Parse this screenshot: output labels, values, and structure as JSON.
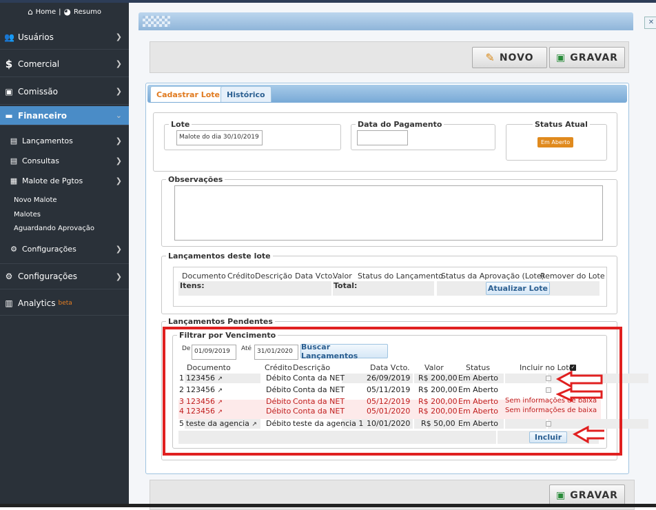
{
  "sidebar": {
    "home_label": "Home",
    "sep": "|",
    "resumo_label": "Resumo",
    "items": [
      {
        "label": "Usuários",
        "icon": "users-icon",
        "glyph": "👥"
      },
      {
        "label": "Comercial",
        "icon": "dollar-icon",
        "glyph": "$"
      },
      {
        "label": "Comissão",
        "icon": "money-icon",
        "glyph": "▣"
      },
      {
        "label": "Financeiro",
        "icon": "briefcase-icon",
        "glyph": "💼"
      }
    ],
    "financeiro_sub": [
      {
        "label": "Lançamentos",
        "icon": "file-icon",
        "glyph": "▤"
      },
      {
        "label": "Consultas",
        "icon": "file-text-icon",
        "glyph": "▤"
      },
      {
        "label": "Malote de Pgtos",
        "icon": "list-icon",
        "glyph": "▦"
      }
    ],
    "malote_sub": [
      "Novo Malote",
      "Malotes",
      "Aguardando Aprovação"
    ],
    "fin_config": "Configurações",
    "config": "Configurações",
    "analytics": "Analytics",
    "beta": "beta"
  },
  "toolbar": {
    "novo": "NOVO",
    "gravar": "GRAVAR"
  },
  "tabs": {
    "cadastrar": "Cadastrar Lote",
    "historico": "Histórico"
  },
  "lote": {
    "legend": "Lote",
    "value": "Malote do dia 30/10/2019"
  },
  "pagamento": {
    "legend": "Data do Pagamento",
    "value": ""
  },
  "status": {
    "legend": "Status Atual",
    "badge": "Em Aberto",
    "badge_color": "#e08a1e"
  },
  "observacoes": {
    "legend": "Observações"
  },
  "lancamentos_lote": {
    "legend": "Lançamentos deste lote",
    "headers": [
      "Documento",
      "Crédito",
      "Descrição",
      "Data Vcto.",
      "Valor",
      "Status do Lançamento",
      "Status da Aprovação (Lote)",
      "Remover do Lote"
    ],
    "itens_label": "Itens:",
    "total_label": "Total:",
    "atualizar": "Atualizar Lote"
  },
  "pendentes": {
    "legend": "Lançamentos Pendentes",
    "filtro_legend": "Filtrar por Vencimento",
    "de_label": "De",
    "de_value": "01/09/2019",
    "ate_label": "Até",
    "ate_value": "31/01/2020",
    "buscar": "Buscar Lançamentos",
    "headers": {
      "documento": "Documento",
      "credito": "Crédito",
      "descricao": "Descrição",
      "vcto": "Data Vcto.",
      "valor": "Valor",
      "status": "Status",
      "incluir": "Incluir no Lote"
    },
    "rows": [
      {
        "n": "1",
        "doc": "123456",
        "cred": "Débito",
        "desc": "Conta da NET",
        "vcto": "26/09/2019",
        "valor": "R$ 200,00",
        "status": "Em Aberto",
        "incl": "",
        "red": false
      },
      {
        "n": "2",
        "doc": "123456",
        "cred": "Débito",
        "desc": "Conta da NET",
        "vcto": "05/11/2019",
        "valor": "R$ 200,00",
        "status": "Em Aberto",
        "incl": "",
        "red": false
      },
      {
        "n": "3",
        "doc": "123456",
        "cred": "Débito",
        "desc": "Conta da NET",
        "vcto": "05/12/2019",
        "valor": "R$ 200,00",
        "status": "Em Aberto",
        "incl": "Sem informações de baixa",
        "red": true
      },
      {
        "n": "4",
        "doc": "123456",
        "cred": "Débito",
        "desc": "Conta da NET",
        "vcto": "05/01/2020",
        "valor": "R$ 200,00",
        "status": "Em Aberto",
        "incl": "Sem informações de baixa",
        "red": true
      },
      {
        "n": "5",
        "doc": "teste da agencia",
        "cred": "Débito",
        "desc": "teste da agencia 1",
        "vcto": "10/01/2020",
        "valor": "R$ 50,00",
        "status": "Em Aberto",
        "incl": "",
        "red": false
      }
    ],
    "incluir": "Incluir"
  },
  "bottom": {
    "gravar": "GRAVAR"
  },
  "colors": {
    "sidebar": "#2a3139",
    "active": "#4a8cc7",
    "highlight": "#e02020",
    "accent": "#e07a1f"
  }
}
